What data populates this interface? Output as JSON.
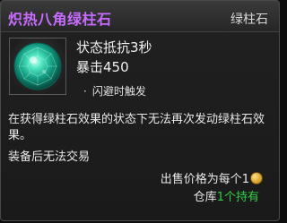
{
  "tooltip": {
    "title": "炽热八角绿柱石",
    "category": "绿柱石",
    "title_color": "#c86cff",
    "item_icon": "green-faceted-gem-icon",
    "stats": [
      "状态抵抗3秒",
      "暴击450"
    ],
    "sub_effect_bullet": "·",
    "sub_effect": "闪避时触发",
    "description": "在获得绿柱石效果的状态下无法再次发动绿柱石效果。",
    "trade_note": "装备后无法交易",
    "sell_price_label": "出售价格为每个1",
    "coin_icon": "gold-coin-icon",
    "storage_label": "仓库",
    "storage_count": "1个持有",
    "storage_count_color": "#2fd046"
  }
}
